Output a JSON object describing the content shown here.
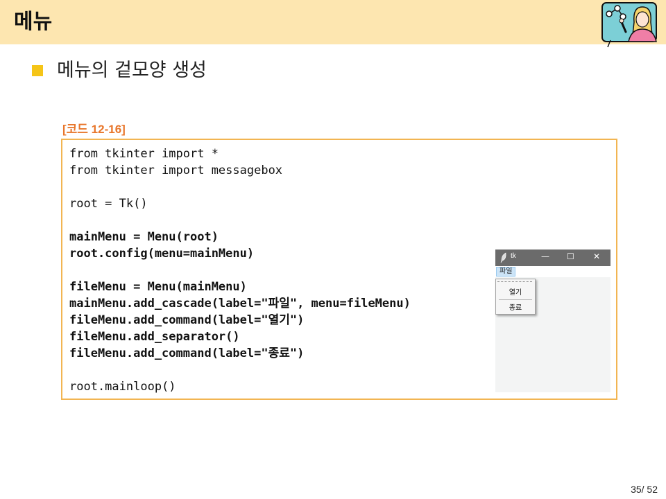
{
  "header": {
    "title": "메뉴"
  },
  "bullet": {
    "text": "메뉴의 겉모양 생성"
  },
  "code": {
    "caption": "[코드 12-16]",
    "lines": [
      {
        "text": "from tkinter import *",
        "bold": false
      },
      {
        "text": "from tkinter import messagebox",
        "bold": false
      },
      {
        "text": "",
        "bold": false
      },
      {
        "text": "root = Tk()",
        "bold": false
      },
      {
        "text": "",
        "bold": false
      },
      {
        "text": "mainMenu = Menu(root)",
        "bold": true
      },
      {
        "text": "root.config(menu=mainMenu)",
        "bold": true
      },
      {
        "text": "",
        "bold": false
      },
      {
        "text": "fileMenu = Menu(mainMenu)",
        "bold": true
      },
      {
        "text": "mainMenu.add_cascade(label=\"파일\", menu=fileMenu)",
        "bold": true
      },
      {
        "text": "fileMenu.add_command(label=\"열기\")",
        "bold": true
      },
      {
        "text": "fileMenu.add_separator()",
        "bold": true
      },
      {
        "text": "fileMenu.add_command(label=\"종료\")",
        "bold": true
      },
      {
        "text": "",
        "bold": false
      },
      {
        "text": "root.mainloop()",
        "bold": false
      }
    ]
  },
  "tk_window": {
    "title": "tk",
    "minimize": "—",
    "maximize": "☐",
    "close": "✕",
    "menu_label": "파일",
    "menu_items": [
      "열기",
      "종료"
    ]
  },
  "footer": {
    "page_number": "35/ 52"
  },
  "colors": {
    "header_bg": "#fde6b0",
    "bullet": "#f5c518",
    "caption": "#e8762b",
    "code_border": "#f2b552"
  }
}
